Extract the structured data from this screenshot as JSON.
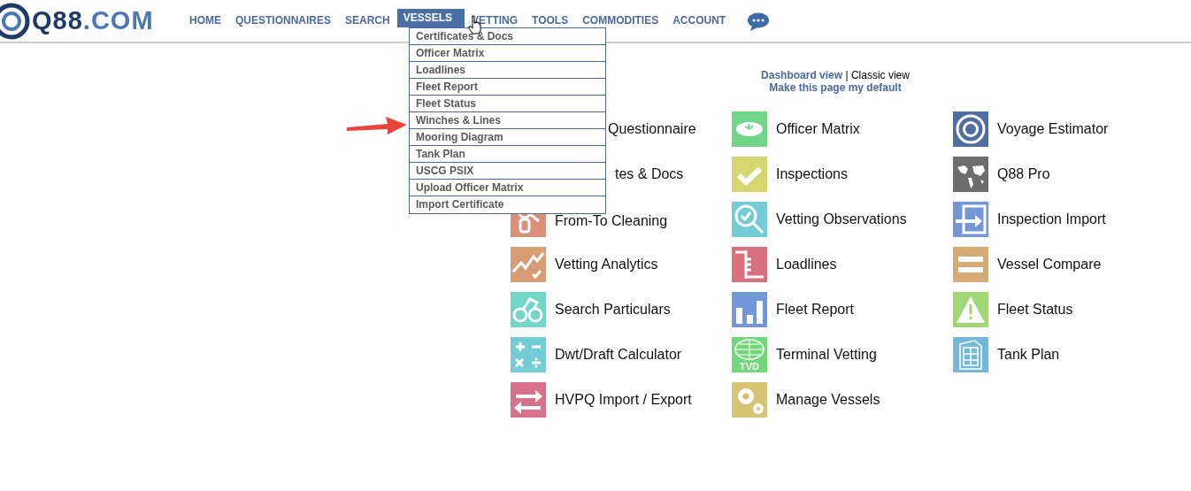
{
  "logo": {
    "name": "Q88",
    "suffix": ".COM"
  },
  "nav": [
    {
      "label": "HOME",
      "selected": false
    },
    {
      "label": "QUESTIONNAIRES",
      "selected": false
    },
    {
      "label": "SEARCH",
      "selected": false
    },
    {
      "label": "VESSELS",
      "selected": true
    },
    {
      "label": "VETTING",
      "selected": false
    },
    {
      "label": "TOOLS",
      "selected": false
    },
    {
      "label": "COMMODITIES",
      "selected": false
    },
    {
      "label": "ACCOUNT",
      "selected": false
    }
  ],
  "dropdown": [
    "Certificates & Docs",
    "Officer Matrix",
    "Loadlines",
    "Fleet Report",
    "Fleet Status",
    "Winches & Lines",
    "Mooring Diagram",
    "Tank Plan",
    "USCG PSIX",
    "Upload Officer Matrix",
    "Import Certificate"
  ],
  "view_links": {
    "dashboard": "Dashboard view",
    "separator": "|",
    "classic": "Classic view",
    "default": "Make this page my default"
  },
  "tiles": [
    {
      "label": "Questionnaire",
      "kind": "covered"
    },
    {
      "label": "Officer Matrix",
      "kind": "cap",
      "color": "#72d68a"
    },
    {
      "label": "Voyage Estimator",
      "kind": "swirl",
      "color": "#4e6fa0"
    },
    {
      "label": "tes & Docs",
      "kind": "covered"
    },
    {
      "label": "Inspections",
      "kind": "check",
      "color": "#d6d670"
    },
    {
      "label": "Q88 Pro",
      "kind": "map",
      "color": "#6d6d6d"
    },
    {
      "label": "From-To Cleaning",
      "kind": "cleaning",
      "color": "#d98f78"
    },
    {
      "label": "Vetting Observations",
      "kind": "magnifier",
      "color": "#74ccd6"
    },
    {
      "label": "Inspection Import",
      "kind": "import",
      "color": "#7497d8"
    },
    {
      "label": "Vetting Analytics",
      "kind": "analytics",
      "color": "#d89c74"
    },
    {
      "label": "Loadlines",
      "kind": "loadlines",
      "color": "#d8707e"
    },
    {
      "label": "Vessel Compare",
      "kind": "equals",
      "color": "#d6ac74"
    },
    {
      "label": "Search Particulars",
      "kind": "binoculars",
      "color": "#72d6c8"
    },
    {
      "label": "Fleet Report",
      "kind": "bars",
      "color": "#7497d8"
    },
    {
      "label": "Fleet Status",
      "kind": "warning",
      "color": "#a0d674"
    },
    {
      "label": "Dwt/Draft Calculator",
      "kind": "calculator",
      "color": "#74ccd6"
    },
    {
      "label": "Terminal Vetting",
      "kind": "globe",
      "color": "#72d67a",
      "badge": "TVD"
    },
    {
      "label": "Tank Plan",
      "kind": "tank",
      "color": "#74b8d8"
    },
    {
      "label": "HVPQ Import / Export",
      "kind": "transfer",
      "color": "#d8728a"
    },
    {
      "label": "Manage Vessels",
      "kind": "gears",
      "color": "#d6c474"
    }
  ]
}
